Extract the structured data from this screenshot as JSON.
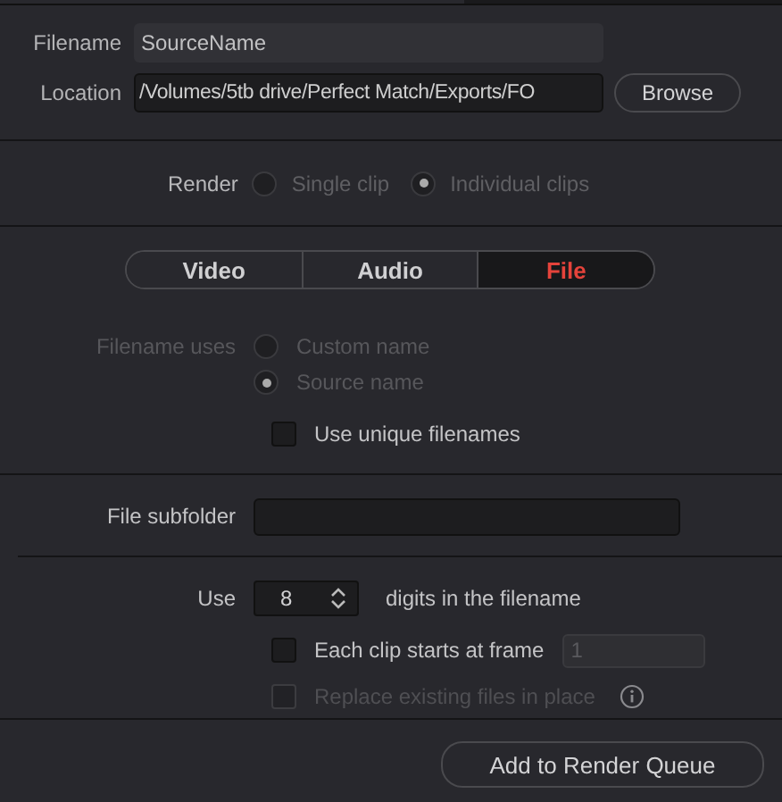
{
  "filename": {
    "label": "Filename",
    "value": "SourceName"
  },
  "location": {
    "label": "Location",
    "value": "/Volumes/5tb drive/Perfect Match/Exports/FO"
  },
  "browse_button": "Browse",
  "render": {
    "label": "Render",
    "options": [
      {
        "label": "Single clip",
        "selected": false
      },
      {
        "label": "Individual clips",
        "selected": true
      }
    ]
  },
  "tabs": [
    {
      "label": "Video",
      "selected": false
    },
    {
      "label": "Audio",
      "selected": false
    },
    {
      "label": "File",
      "selected": true
    }
  ],
  "filename_uses": {
    "label": "Filename uses",
    "disabled": true,
    "options": [
      {
        "label": "Custom name",
        "selected": false
      },
      {
        "label": "Source name",
        "selected": true
      }
    ]
  },
  "unique_filenames": {
    "label": "Use unique filenames",
    "checked": false
  },
  "file_subfolder": {
    "label": "File subfolder"
  },
  "digits": {
    "label_before": "Use",
    "value": "8",
    "label_after": "digits in the filename"
  },
  "each_clip_start": {
    "label": "Each clip starts at frame",
    "checked": false,
    "frame_value": "1",
    "frame_disabled": true
  },
  "replace_existing": {
    "label": "Replace existing files in place",
    "checked": false,
    "disabled": true
  },
  "add_button": "Add to Render Queue"
}
